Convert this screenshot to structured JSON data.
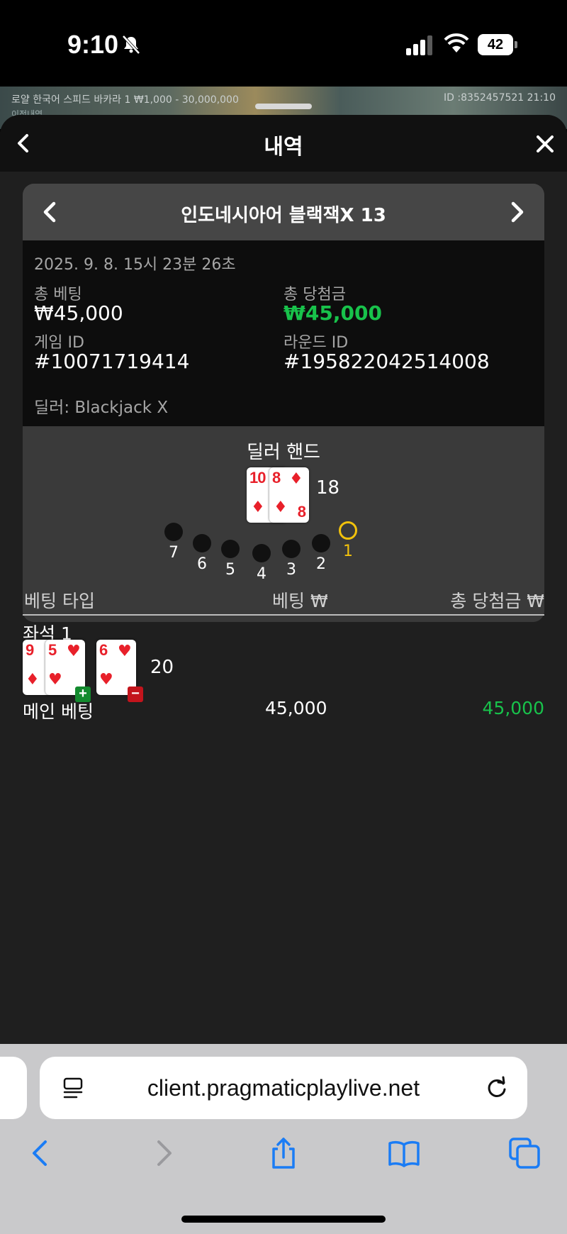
{
  "status_bar": {
    "time": "9:10",
    "battery": "42"
  },
  "game_strip": {
    "table_info": "로얄 한국어 스피드 바카라 1 ₩1,000 - 30,000,000",
    "sub_info": "이전내역",
    "id_info": "ID :8352457521 21:10"
  },
  "sheet": {
    "title": "내역"
  },
  "panel": {
    "game_title": "인도네시아어 블랙잭X 13",
    "datetime": "2025. 9. 8. 15시 23분 26초",
    "total_bet_label": "총 베팅",
    "total_bet_value": "₩45,000",
    "total_win_label": "총 당첨금",
    "total_win_value": "₩45,000",
    "game_id_label": "게임 ID",
    "game_id_value": "#10071719414",
    "round_id_label": "라운드 ID",
    "round_id_value": "#195822042514008",
    "dealer_line": "딜러: Blackjack X",
    "dealer_hand_title": "딜러 핸드",
    "dealer_score": "18",
    "dealer_cards": [
      {
        "rank": "10",
        "suit": "♦"
      },
      {
        "rank": "8",
        "suit": "♦"
      }
    ],
    "seats": [
      "7",
      "6",
      "5",
      "4",
      "3",
      "2",
      "1"
    ],
    "active_seat": "1"
  },
  "bets": {
    "col_type": "베팅 타입",
    "col_bet": "베팅 ₩",
    "col_win": "총 당첨금 ₩",
    "seat_label": "좌석 1",
    "hand_score": "20",
    "player_cards": [
      {
        "rank": "9",
        "suit": "♦"
      },
      {
        "rank": "5",
        "suit": "♥"
      },
      {
        "rank": "6",
        "suit": "♥"
      }
    ],
    "badge_plus": "+",
    "badge_minus": "−",
    "row_label": "메인 베팅",
    "row_bet": "45,000",
    "row_win": "45,000"
  },
  "browser": {
    "url": "client.pragmaticplaylive.net"
  },
  "colors": {
    "win_green": "#18c24b",
    "seat_active": "#f2c20c",
    "card_red": "#e8202a",
    "ios_blue": "#1a7cf5"
  },
  "icons": [
    "bell-slash-icon",
    "cellular-signal-icon",
    "wifi-icon",
    "battery-icon",
    "chevron-left-icon",
    "close-icon",
    "chevron-right-icon",
    "reader-icon",
    "reload-icon",
    "share-icon",
    "book-icon",
    "tabs-icon"
  ]
}
